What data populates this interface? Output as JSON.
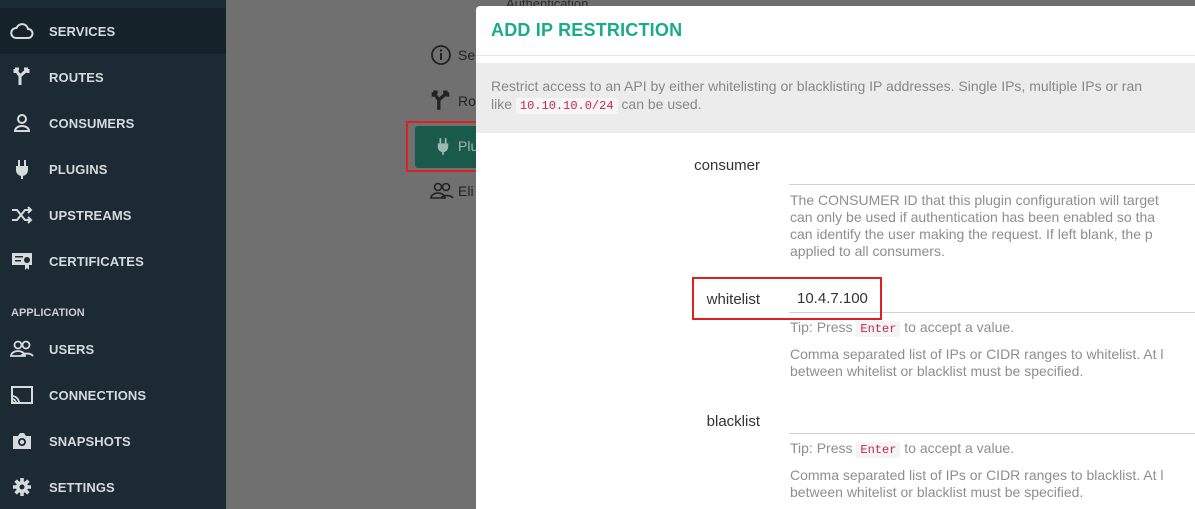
{
  "sidebar": {
    "items": [
      {
        "label": "SERVICES",
        "icon": "cloud-icon"
      },
      {
        "label": "ROUTES",
        "icon": "routes-icon"
      },
      {
        "label": "CONSUMERS",
        "icon": "user-icon"
      },
      {
        "label": "PLUGINS",
        "icon": "plug-icon"
      },
      {
        "label": "UPSTREAMS",
        "icon": "shuffle-icon"
      },
      {
        "label": "CERTIFICATES",
        "icon": "certificate-icon"
      }
    ],
    "section_label": "APPLICATION",
    "app_items": [
      {
        "label": "USERS",
        "icon": "users-icon"
      },
      {
        "label": "CONNECTIONS",
        "icon": "cast-icon"
      },
      {
        "label": "SNAPSHOTS",
        "icon": "camera-icon"
      },
      {
        "label": "SETTINGS",
        "icon": "gear-icon"
      }
    ]
  },
  "middle": {
    "top_text": "Authentication",
    "items": [
      {
        "label": "Se",
        "icon": "info-icon"
      },
      {
        "label": "Ro",
        "icon": "routes-icon"
      },
      {
        "label": "Plu",
        "icon": "plug-icon"
      },
      {
        "label": "Eli",
        "icon": "users-icon"
      }
    ]
  },
  "modal": {
    "title": "ADD IP RESTRICTION",
    "description_line1": "Restrict access to an API by either whitelisting or blacklisting IP addresses. Single IPs, multiple IPs or ran",
    "description_line2_prefix": "like",
    "description_code": "10.10.10.0/24",
    "description_line2_suffix": "can be used.",
    "fields": {
      "consumer": {
        "label": "consumer",
        "value": "",
        "help": [
          "The CONSUMER ID that this plugin configuration will target",
          "can only be used if authentication has been enabled so tha",
          "can identify the user making the request. If left blank, the p",
          "applied to all consumers."
        ]
      },
      "whitelist": {
        "label": "whitelist",
        "value": "10.4.7.100",
        "tip_prefix": "Tip: Press",
        "tip_key": "Enter",
        "tip_suffix": "to accept a value.",
        "help": [
          "Comma separated list of IPs or CIDR ranges to whitelist. At l",
          "between whitelist or blacklist must be specified."
        ]
      },
      "blacklist": {
        "label": "blacklist",
        "value": "",
        "tip_prefix": "Tip: Press",
        "tip_key": "Enter",
        "tip_suffix": "to accept a value.",
        "help": [
          "Comma separated list of IPs or CIDR ranges to blacklist. At l",
          "between whitelist or blacklist must be specified."
        ]
      }
    }
  },
  "colors": {
    "sidebar_bg": "#1c2a33",
    "accent": "#1aab8a",
    "highlight": "#e02020"
  }
}
